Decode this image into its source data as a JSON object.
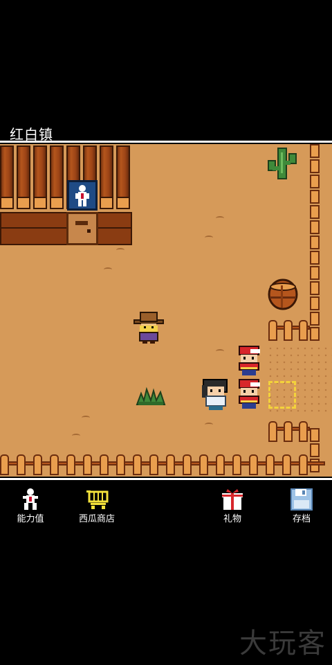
{
  "location": {
    "title": "红白镇"
  },
  "nav": {
    "stats_label": "能力值",
    "shop_label": "西瓜商店",
    "gift_label": "礼物",
    "save_label": "存档"
  },
  "watermark": "大玩客",
  "colors": {
    "ground": "#d69a59",
    "fence": "#e99e4e",
    "selection": "#f3d23b",
    "sign": "#1f4b85"
  },
  "icons": [
    "stats-person-icon",
    "shopping-cart-icon",
    "gift-box-icon",
    "floppy-disk-icon"
  ]
}
